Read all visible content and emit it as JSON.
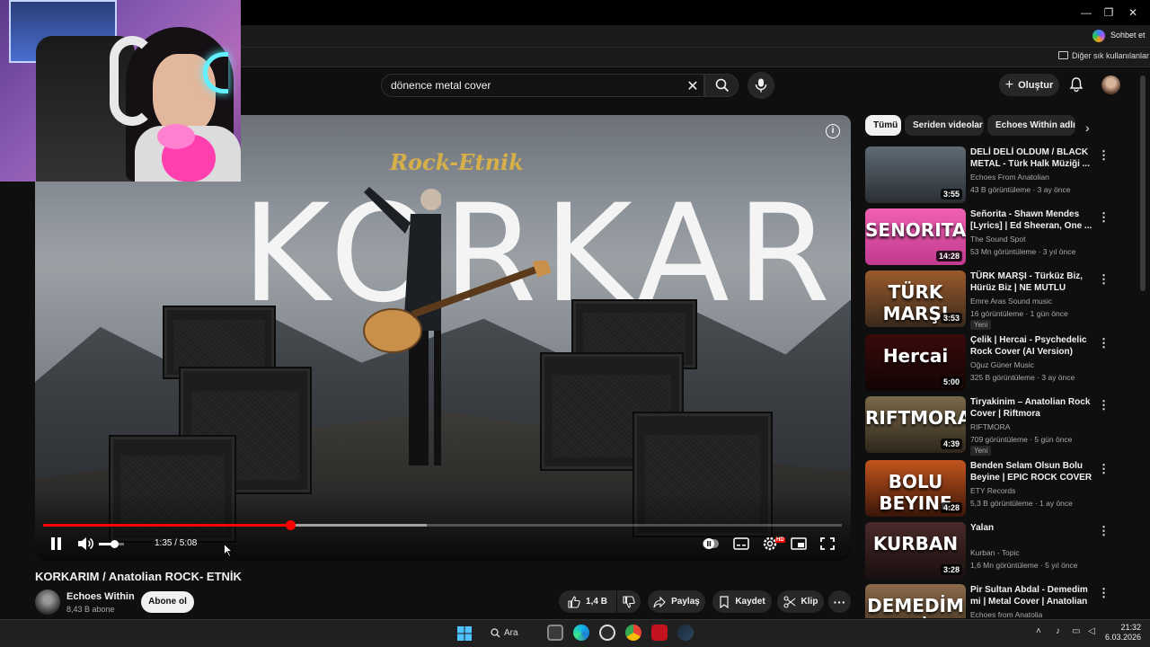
{
  "browser": {
    "favorites_label": "Diğer sık kullanılanlar",
    "copilot_label": "Sohbet et"
  },
  "header": {
    "search_value": "dönence metal cover",
    "create_label": "Oluştur"
  },
  "player": {
    "overlay_logo": "Rock-Etnik",
    "overlay_title": "KORKARIM",
    "time_display": "1:35 / 5:08",
    "progress_fraction": 0.309,
    "buffer_fraction": 0.48,
    "volume_fraction": 0.6
  },
  "video": {
    "title": "KORKARIM / Anatolian ROCK- ETNİK",
    "channel_name": "Echoes Within",
    "channel_subs": "8,43 B abone",
    "subscribe_label": "Abone ol",
    "like_count": "1,4 B",
    "share_label": "Paylaş",
    "save_label": "Kaydet",
    "clip_label": "Klip"
  },
  "chips": [
    "Tümü",
    "Seriden videolar",
    "Echoes Within adlı yü"
  ],
  "recommendations": [
    {
      "title": "DELİ DELİ OLDUM / BLACK METAL - Türk Halk Müziği ...",
      "channel": "Echoes From Anatolian",
      "stats": "43 B görüntüleme · 3 ay önce",
      "duration": "3:55",
      "thumb_text": "",
      "thumb_colors": [
        "#5e6a74",
        "#2b2f34"
      ],
      "badge": ""
    },
    {
      "title": "Señorita - Shawn Mendes [Lyrics] | Ed Sheeran, One ...",
      "channel": "The Sound Spot",
      "stats": "53 Mn görüntüleme · 3 yıl önce",
      "duration": "14:28",
      "thumb_text": "SENORITA",
      "thumb_colors": [
        "#f05fb2",
        "#c03a8f"
      ],
      "badge": ""
    },
    {
      "title": "TÜRK MARŞI - Türküz Biz, Hürüz Biz | NE MUTLU TÜRKÜ...",
      "channel": "Emre Aras Sound music",
      "stats": "16 görüntüleme · 1 gün önce",
      "duration": "3:53",
      "thumb_text": "TÜRK MARŞI",
      "thumb_colors": [
        "#9a5a2c",
        "#3a2a1c"
      ],
      "badge": "Yeni"
    },
    {
      "title": "Çelik | Hercai - Psychedelic Rock Cover (AI Version)",
      "channel": "Oğuz Güner Music",
      "stats": "325 B görüntüleme · 3 ay önce",
      "duration": "5:00",
      "thumb_text": "Hercai",
      "thumb_colors": [
        "#3a0b0b",
        "#120404"
      ],
      "badge": ""
    },
    {
      "title": "Tiryakinim – Anatolian Rock Cover | Riftmora",
      "channel": "RIFTMORA",
      "stats": "709 görüntüleme · 5 gün önce",
      "duration": "4:39",
      "thumb_text": "RIFTMORA",
      "thumb_colors": [
        "#7a6a4a",
        "#2e261a"
      ],
      "badge": "Yeni"
    },
    {
      "title": "Benden Selam Olsun Bolu Beyine | EPIC ROCK COVER | E...",
      "channel": "ETY Records",
      "stats": "5,3 B görüntüleme · 1 ay önce",
      "duration": "4:28",
      "thumb_text": "BOLU BEYINE",
      "thumb_colors": [
        "#c2551e",
        "#3a1608"
      ],
      "badge": ""
    },
    {
      "title": "Yalan",
      "channel": "Kurban - Topic",
      "stats": "1,6 Mn görüntüleme · 5 yıl önce",
      "duration": "3:28",
      "thumb_text": "KURBAN",
      "thumb_colors": [
        "#4a2a2a",
        "#1a0f0f"
      ],
      "badge": ""
    },
    {
      "title": "Pir Sultan Abdal - Demedim mi | Metal Cover | Anatolian Folk | ...",
      "channel": "Echoes from Anatolia",
      "stats": "",
      "duration": "",
      "thumb_text": "DEMEDİM Mİ",
      "thumb_colors": [
        "#8a6a4a",
        "#3a2a1a"
      ],
      "badge": ""
    }
  ],
  "taskbar": {
    "search_label": "Ara",
    "time": "21:32",
    "date": "6.03.2026"
  }
}
